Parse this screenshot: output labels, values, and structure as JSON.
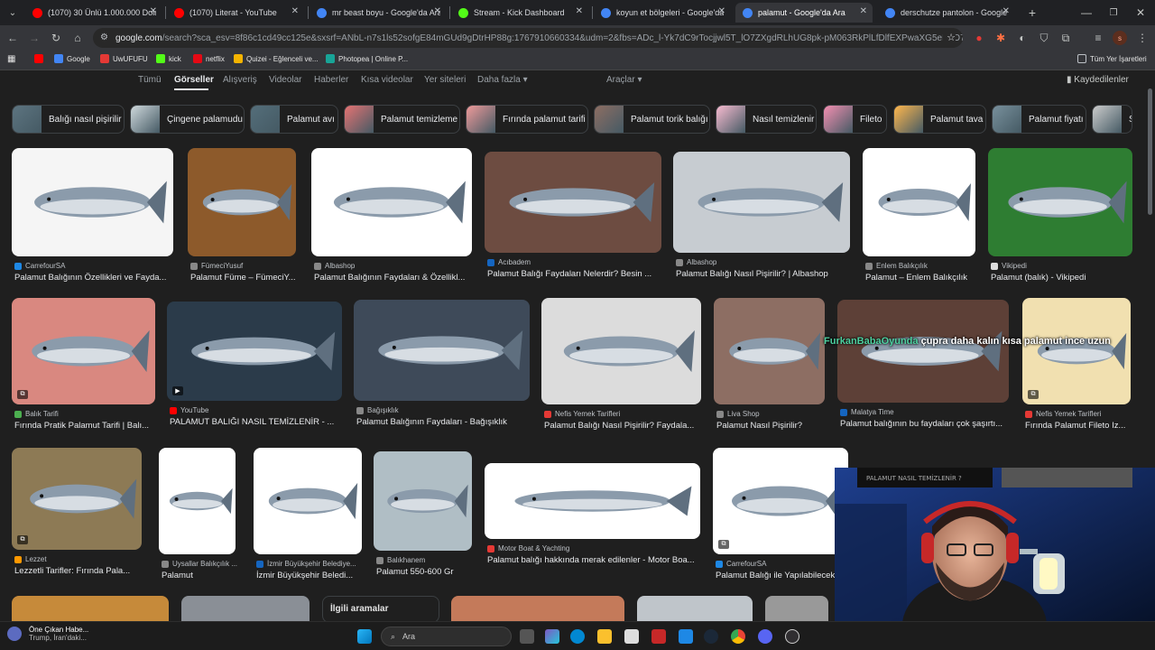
{
  "tabs": [
    {
      "title": "(1070) 30 Ünlü 1.000.000 Dola",
      "icon": "youtube",
      "color": "#ff0000"
    },
    {
      "title": "(1070) Literat - YouTube",
      "icon": "youtube",
      "color": "#ff0000"
    },
    {
      "title": "mr beast boyu - Google'da Ara",
      "icon": "google",
      "color": "#4285f4"
    },
    {
      "title": "Stream - Kick Dashboard",
      "icon": "kick",
      "color": "#53fc18"
    },
    {
      "title": "koyun et bölgeleri - Google'da",
      "icon": "google",
      "color": "#4285f4"
    },
    {
      "title": "palamut - Google'da Ara",
      "icon": "google",
      "color": "#4285f4",
      "active": true
    },
    {
      "title": "derschutze pantolon - Google",
      "icon": "google",
      "color": "#4285f4"
    }
  ],
  "omnibox": {
    "host": "google.com",
    "path": "/search?sca_esv=8f86c1cd49cc125e&sxsrf=ANbL-n7s1ls52sofgE84mGUd9gDtrHP88g:1767910660334&udm=2&fbs=ADc_l-Yk7dC9rTocjjwl5T_lO7ZXgdRLhUG8pk-pM063RkPlLfDlfEXPwaXG5eHvO7qyO_mxvB-..."
  },
  "bookmarks": [
    {
      "label": "",
      "color": "#ff0000"
    },
    {
      "label": "Google",
      "color": "#4285f4"
    },
    {
      "label": "UwUFUFU",
      "color": "#e53935"
    },
    {
      "label": "kick",
      "color": "#53fc18"
    },
    {
      "label": "netflix",
      "color": "#e50914"
    },
    {
      "label": "Quizei - Eğlenceli ve...",
      "color": "#f5b400"
    },
    {
      "label": "Photopea | Online P...",
      "color": "#18a497"
    }
  ],
  "bookmarks_all": "Tüm Yer İşaretleri",
  "nav": {
    "items": [
      "Tümü",
      "Görseller",
      "Alışveriş",
      "Videolar",
      "Haberler",
      "Kısa videolar",
      "Yer siteleri",
      "Daha fazla ▾"
    ],
    "tools": "Araçlar ▾",
    "saved": "Kaydedilenler"
  },
  "chips": [
    "Balığı nasıl pişirilir",
    "Çingene palamudu",
    "Palamut avı",
    "Palamut temizleme",
    "Fırında palamut tarifi",
    "Palamut torik balığı",
    "Nasıl temizlenir",
    "Fileto",
    "Palamut tava",
    "Palamut fiyatı",
    "S"
  ],
  "results": [
    {
      "source": "CarrefourSA",
      "title": "Palamut Balığının Özellikleri ve Fayda...",
      "color": "#1e88e5"
    },
    {
      "source": "FümeciYusuf",
      "title": "Palamut Füme – FümeciY...",
      "color": "#888"
    },
    {
      "source": "Albashop",
      "title": "Palamut Balığının Faydaları & Özellikl...",
      "color": "#888"
    },
    {
      "source": "Acıbadem",
      "title": "Palamut Balığı Faydaları Nelerdir? Besin ...",
      "color": "#1565c0"
    },
    {
      "source": "Albashop",
      "title": "Palamut Balığı Nasıl Pişirilir? | Albashop",
      "color": "#888"
    },
    {
      "source": "Enlem Balıkçılık",
      "title": "Palamut – Enlem Balıkçılık",
      "color": "#888"
    },
    {
      "source": "Vikipedi",
      "title": "Palamut (balık) - Vikipedi",
      "color": "#ddd"
    },
    {
      "source": "Balık Tarifi",
      "title": "Fırında Pratik Palamut Tarifi | Balı...",
      "color": "#4caf50"
    },
    {
      "source": "YouTube",
      "title": "PALAMUT BALIĞI NASIL TEMİZLENİR - ...",
      "color": "#ff0000"
    },
    {
      "source": "Bağışıklık",
      "title": "Palamut Balığının Faydaları - Bağışıklık",
      "color": "#888"
    },
    {
      "source": "Nefis Yemek Tarifleri",
      "title": "Palamut Balığı Nasıl Pişirilir? Faydala...",
      "color": "#e53935"
    },
    {
      "source": "Liva Shop",
      "title": "Palamut Nasıl Pişirilir?",
      "color": "#888"
    },
    {
      "source": "Malatya Time",
      "title": "Palamut balığının bu faydaları çok şaşırtı...",
      "color": "#1565c0"
    },
    {
      "source": "Nefis Yemek Tarifleri",
      "title": "Fırında Palamut Fileto Iz...",
      "color": "#e53935"
    },
    {
      "source": "Lezzet",
      "title": "Lezzetli Tarifler: Fırında Pala...",
      "color": "#ff9800"
    },
    {
      "source": "Uysallar Balıkçılık ...",
      "title": "Palamut",
      "color": "#888"
    },
    {
      "source": "İzmir Büyükşehir Belediye...",
      "title": "İzmir Büyükşehir Beledi...",
      "color": "#1565c0"
    },
    {
      "source": "Balıkhanem",
      "title": "Palamut 550-600 Gr",
      "color": "#888"
    },
    {
      "source": "Motor Boat & Yachting",
      "title": "Palamut balığı hakkında merak edilenler - Motor Boa...",
      "color": "#e53935"
    },
    {
      "source": "CarrefourSA",
      "title": "Palamut Balığı ile Yapılabilecek...",
      "color": "#1e88e5"
    }
  ],
  "overlay_text": "FurkanBabaOyunda çupra daha kalın kısa palamut ince uzun",
  "related": "İlgili aramalar",
  "news": {
    "title": "Öne Çıkan Habe...",
    "sub": "Trump, İran'daki..."
  },
  "search_placeholder": "Ara",
  "cam_banner": "PALAMUT NASIL TEMİZLENİR ?"
}
